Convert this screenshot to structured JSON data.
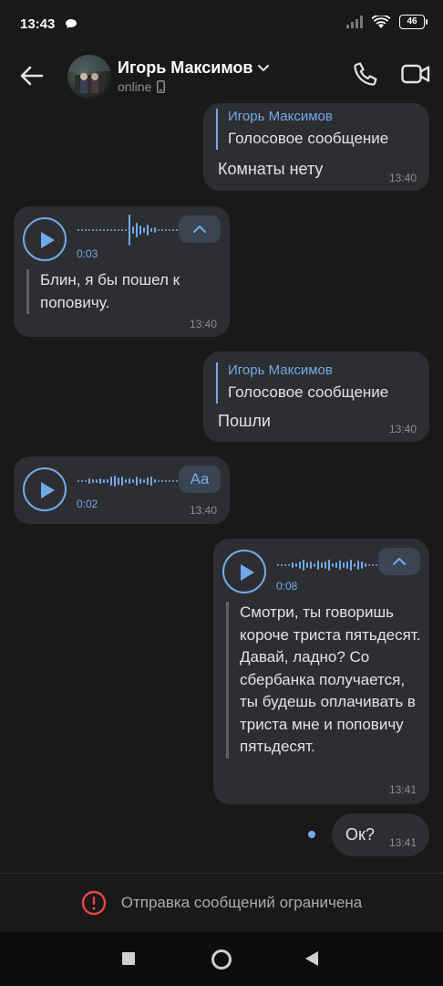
{
  "status_bar": {
    "time": "13:43",
    "battery": "46"
  },
  "header": {
    "contact_name": "Игорь Максимов",
    "status": "online"
  },
  "messages": [
    {
      "direction": "outgoing",
      "reply_name": "Игорь Максимов",
      "reply_text": "Голосовое сообщение",
      "text": "Комнаты нету",
      "time": "13:40"
    },
    {
      "direction": "incoming",
      "type": "voice",
      "duration": "0:03",
      "transcript": "Блин, я бы пошел к поповичу.",
      "time": "13:40"
    },
    {
      "direction": "outgoing",
      "reply_name": "Игорь Максимов",
      "reply_text": "Голосовое сообщение",
      "text": "Пошли",
      "time": "13:40"
    },
    {
      "direction": "incoming",
      "type": "voice",
      "duration": "0:02",
      "chip_label": "Aa",
      "time": "13:40"
    },
    {
      "direction": "outgoing",
      "type": "voice",
      "duration": "0:08",
      "transcript": "Смотри, ты говоришь короче триста пятьдесят. Давай, ладно? Со сбербанка получается, ты будешь оплачивать в триста мне и поповичу пятьдесят.",
      "time": "13:41"
    },
    {
      "direction": "outgoing",
      "text": "Ок?",
      "time": "13:41",
      "unread": true
    }
  ],
  "footer": {
    "restriction_text": "Отправка сообщений ограничена"
  },
  "colors": {
    "background": "#19191a",
    "bubble": "#2d2e31",
    "accent": "#71aaeb",
    "warning": "#e64646"
  }
}
